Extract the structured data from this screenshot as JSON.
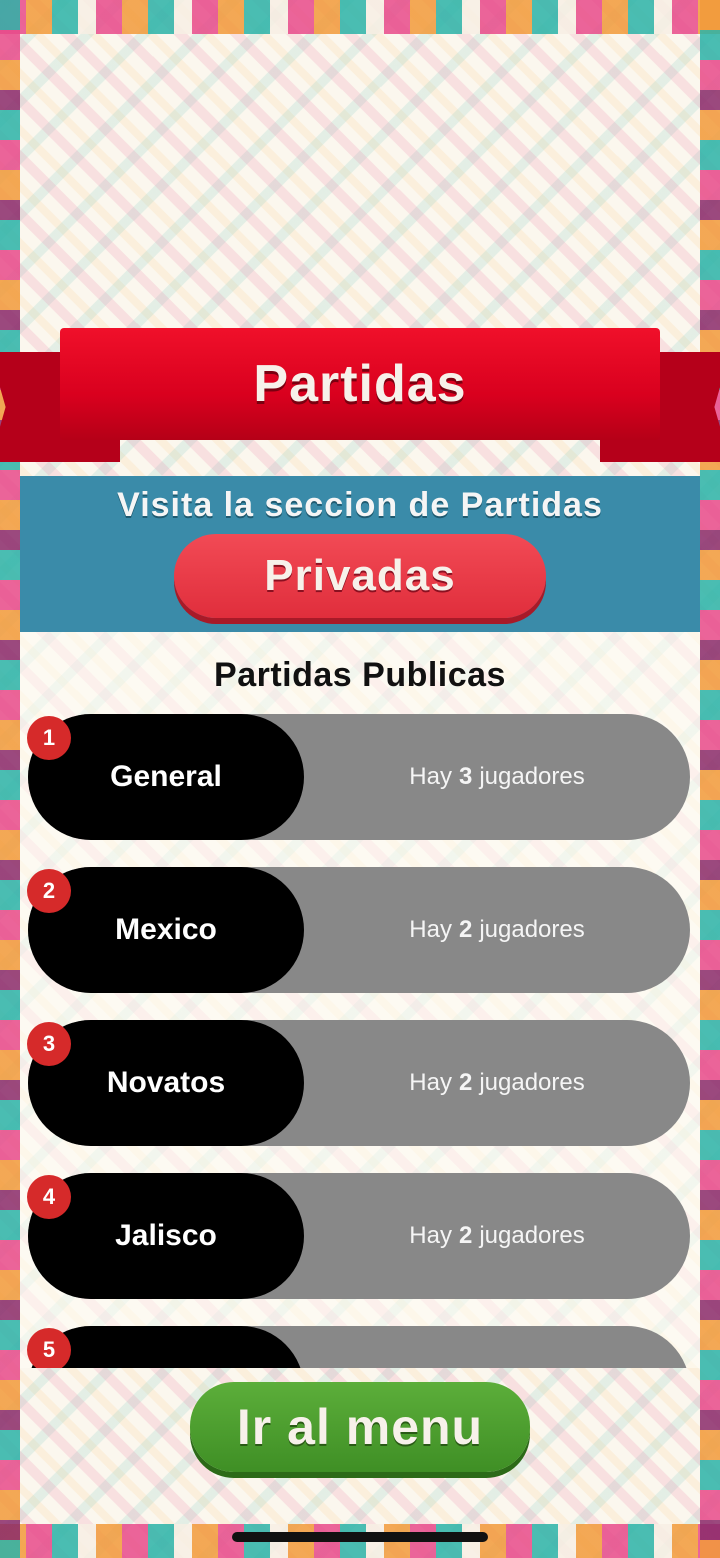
{
  "header": {
    "title": "Partidas"
  },
  "private_banner": {
    "text": "Visita la seccion de Partidas",
    "button_label": "Privadas"
  },
  "public_section": {
    "title": "Partidas Publicas",
    "rooms": [
      {
        "index": "1",
        "name": "General",
        "prefix": "Hay",
        "count": "3",
        "suffix": "jugadores"
      },
      {
        "index": "2",
        "name": "Mexico",
        "prefix": "Hay",
        "count": "2",
        "suffix": "jugadores"
      },
      {
        "index": "3",
        "name": "Novatos",
        "prefix": "Hay",
        "count": "2",
        "suffix": "jugadores"
      },
      {
        "index": "4",
        "name": "Jalisco",
        "prefix": "Hay",
        "count": "2",
        "suffix": "jugadores"
      },
      {
        "index": "5",
        "name": "",
        "prefix": "",
        "count": "",
        "suffix": ""
      }
    ]
  },
  "footer": {
    "menu_label": "Ir al menu"
  },
  "colors": {
    "ribbon": "#d9001e",
    "banner": "#3a8ba9",
    "private_button": "#e02e3c",
    "menu_button": "#4a9a2c",
    "badge": "#d62a2a",
    "row_bg": "#888888",
    "name_bg": "#000000"
  }
}
